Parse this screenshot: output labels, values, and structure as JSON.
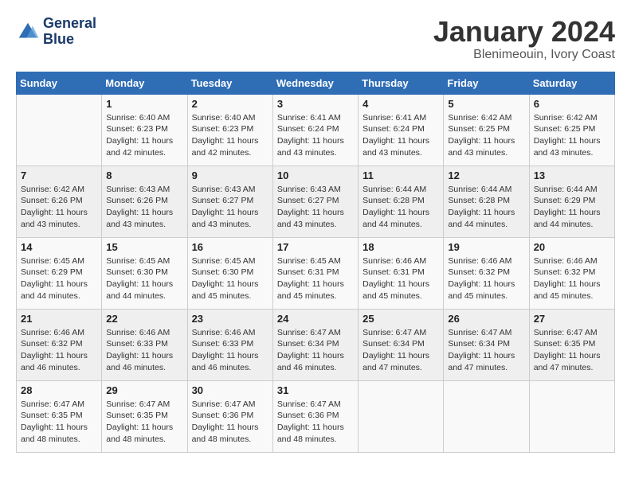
{
  "header": {
    "logo_line1": "General",
    "logo_line2": "Blue",
    "title": "January 2024",
    "subtitle": "Blenimeouin, Ivory Coast"
  },
  "weekdays": [
    "Sunday",
    "Monday",
    "Tuesday",
    "Wednesday",
    "Thursday",
    "Friday",
    "Saturday"
  ],
  "weeks": [
    [
      {
        "day": "",
        "info": ""
      },
      {
        "day": "1",
        "info": "Sunrise: 6:40 AM\nSunset: 6:23 PM\nDaylight: 11 hours\nand 42 minutes."
      },
      {
        "day": "2",
        "info": "Sunrise: 6:40 AM\nSunset: 6:23 PM\nDaylight: 11 hours\nand 42 minutes."
      },
      {
        "day": "3",
        "info": "Sunrise: 6:41 AM\nSunset: 6:24 PM\nDaylight: 11 hours\nand 43 minutes."
      },
      {
        "day": "4",
        "info": "Sunrise: 6:41 AM\nSunset: 6:24 PM\nDaylight: 11 hours\nand 43 minutes."
      },
      {
        "day": "5",
        "info": "Sunrise: 6:42 AM\nSunset: 6:25 PM\nDaylight: 11 hours\nand 43 minutes."
      },
      {
        "day": "6",
        "info": "Sunrise: 6:42 AM\nSunset: 6:25 PM\nDaylight: 11 hours\nand 43 minutes."
      }
    ],
    [
      {
        "day": "7",
        "info": "Sunrise: 6:42 AM\nSunset: 6:26 PM\nDaylight: 11 hours\nand 43 minutes."
      },
      {
        "day": "8",
        "info": "Sunrise: 6:43 AM\nSunset: 6:26 PM\nDaylight: 11 hours\nand 43 minutes."
      },
      {
        "day": "9",
        "info": "Sunrise: 6:43 AM\nSunset: 6:27 PM\nDaylight: 11 hours\nand 43 minutes."
      },
      {
        "day": "10",
        "info": "Sunrise: 6:43 AM\nSunset: 6:27 PM\nDaylight: 11 hours\nand 43 minutes."
      },
      {
        "day": "11",
        "info": "Sunrise: 6:44 AM\nSunset: 6:28 PM\nDaylight: 11 hours\nand 44 minutes."
      },
      {
        "day": "12",
        "info": "Sunrise: 6:44 AM\nSunset: 6:28 PM\nDaylight: 11 hours\nand 44 minutes."
      },
      {
        "day": "13",
        "info": "Sunrise: 6:44 AM\nSunset: 6:29 PM\nDaylight: 11 hours\nand 44 minutes."
      }
    ],
    [
      {
        "day": "14",
        "info": "Sunrise: 6:45 AM\nSunset: 6:29 PM\nDaylight: 11 hours\nand 44 minutes."
      },
      {
        "day": "15",
        "info": "Sunrise: 6:45 AM\nSunset: 6:30 PM\nDaylight: 11 hours\nand 44 minutes."
      },
      {
        "day": "16",
        "info": "Sunrise: 6:45 AM\nSunset: 6:30 PM\nDaylight: 11 hours\nand 45 minutes."
      },
      {
        "day": "17",
        "info": "Sunrise: 6:45 AM\nSunset: 6:31 PM\nDaylight: 11 hours\nand 45 minutes."
      },
      {
        "day": "18",
        "info": "Sunrise: 6:46 AM\nSunset: 6:31 PM\nDaylight: 11 hours\nand 45 minutes."
      },
      {
        "day": "19",
        "info": "Sunrise: 6:46 AM\nSunset: 6:32 PM\nDaylight: 11 hours\nand 45 minutes."
      },
      {
        "day": "20",
        "info": "Sunrise: 6:46 AM\nSunset: 6:32 PM\nDaylight: 11 hours\nand 45 minutes."
      }
    ],
    [
      {
        "day": "21",
        "info": "Sunrise: 6:46 AM\nSunset: 6:32 PM\nDaylight: 11 hours\nand 46 minutes."
      },
      {
        "day": "22",
        "info": "Sunrise: 6:46 AM\nSunset: 6:33 PM\nDaylight: 11 hours\nand 46 minutes."
      },
      {
        "day": "23",
        "info": "Sunrise: 6:46 AM\nSunset: 6:33 PM\nDaylight: 11 hours\nand 46 minutes."
      },
      {
        "day": "24",
        "info": "Sunrise: 6:47 AM\nSunset: 6:34 PM\nDaylight: 11 hours\nand 46 minutes."
      },
      {
        "day": "25",
        "info": "Sunrise: 6:47 AM\nSunset: 6:34 PM\nDaylight: 11 hours\nand 47 minutes."
      },
      {
        "day": "26",
        "info": "Sunrise: 6:47 AM\nSunset: 6:34 PM\nDaylight: 11 hours\nand 47 minutes."
      },
      {
        "day": "27",
        "info": "Sunrise: 6:47 AM\nSunset: 6:35 PM\nDaylight: 11 hours\nand 47 minutes."
      }
    ],
    [
      {
        "day": "28",
        "info": "Sunrise: 6:47 AM\nSunset: 6:35 PM\nDaylight: 11 hours\nand 48 minutes."
      },
      {
        "day": "29",
        "info": "Sunrise: 6:47 AM\nSunset: 6:35 PM\nDaylight: 11 hours\nand 48 minutes."
      },
      {
        "day": "30",
        "info": "Sunrise: 6:47 AM\nSunset: 6:36 PM\nDaylight: 11 hours\nand 48 minutes."
      },
      {
        "day": "31",
        "info": "Sunrise: 6:47 AM\nSunset: 6:36 PM\nDaylight: 11 hours\nand 48 minutes."
      },
      {
        "day": "",
        "info": ""
      },
      {
        "day": "",
        "info": ""
      },
      {
        "day": "",
        "info": ""
      }
    ]
  ]
}
